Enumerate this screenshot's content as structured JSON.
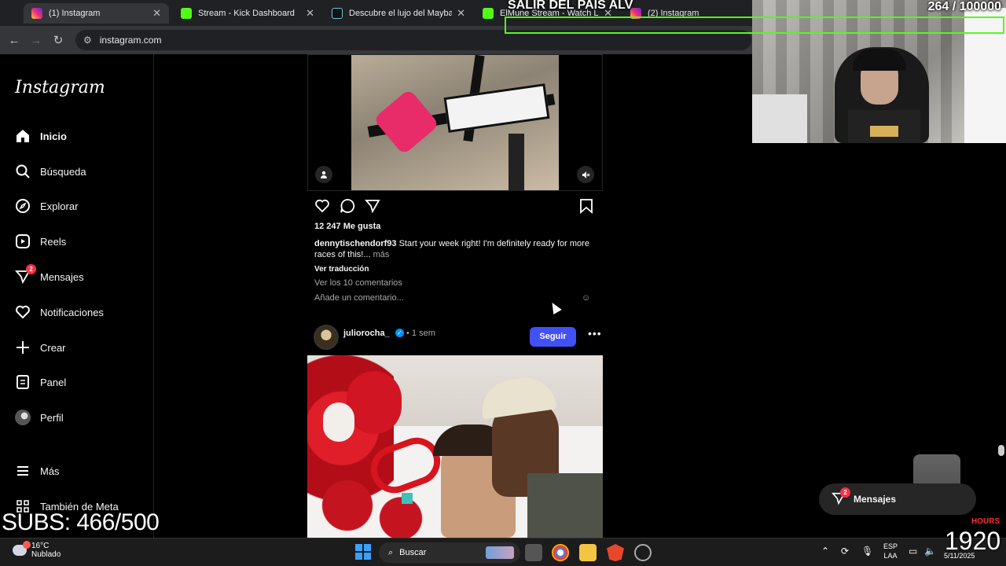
{
  "browser": {
    "tabs": [
      {
        "title": "(1) Instagram",
        "favicon": "instagram-icon",
        "active": true
      },
      {
        "title": "Stream - Kick Dashboard",
        "favicon": "kick-icon"
      },
      {
        "title": "Descubre el lujo del Maybach S",
        "favicon": "tiktok-icon"
      },
      {
        "title": "ElMune Stream - Watch Live o",
        "favicon": "kick-icon"
      },
      {
        "title": "(2) Instagram",
        "favicon": "instagram-icon"
      }
    ],
    "url": "instagram.com"
  },
  "sidebar": {
    "logo": "Instagram",
    "items": [
      {
        "label": "Inicio",
        "icon": "home-icon",
        "bold": true
      },
      {
        "label": "Búsqueda",
        "icon": "search-icon"
      },
      {
        "label": "Explorar",
        "icon": "compass-icon"
      },
      {
        "label": "Reels",
        "icon": "reels-icon"
      },
      {
        "label": "Mensajes",
        "icon": "messenger-icon",
        "badge": "2"
      },
      {
        "label": "Notificaciones",
        "icon": "heart-icon"
      },
      {
        "label": "Crear",
        "icon": "plus-icon"
      },
      {
        "label": "Panel",
        "icon": "dashboard-icon"
      },
      {
        "label": "Perfil",
        "icon": "avatar"
      },
      {
        "label": "Más",
        "icon": "menu-icon"
      },
      {
        "label": "También de Meta",
        "icon": "grid-icon"
      }
    ]
  },
  "post1": {
    "likes": "12 247 Me gusta",
    "username": "dennytischendorf93",
    "caption": "Start your week right! I'm definitely ready for more races of this!...",
    "more": "más",
    "translate": "Ver traducción",
    "comments": "Ver los 10 comentarios",
    "add_comment": "Añade un comentario..."
  },
  "post2": {
    "username": "juliorocha_",
    "time": "• 1 sem",
    "follow": "Seguir"
  },
  "overlay": {
    "goal_text": "SALIR DEL PAIS ALV",
    "goal_count": "264  / 100000",
    "subs": "SUBS: 466/500",
    "hours_label": "HOURS",
    "clock": "1920"
  },
  "messages_bubble": {
    "label": "Mensajes",
    "badge": "2"
  },
  "taskbar": {
    "temperature": "16°C",
    "weather": "Nublado",
    "search": "Buscar",
    "lang1": "ESP",
    "lang2": "LAA",
    "date": "5/11/2025"
  },
  "colors": {
    "accent": "#4150f7",
    "kick": "#53fc18",
    "badge": "#ff3040"
  }
}
